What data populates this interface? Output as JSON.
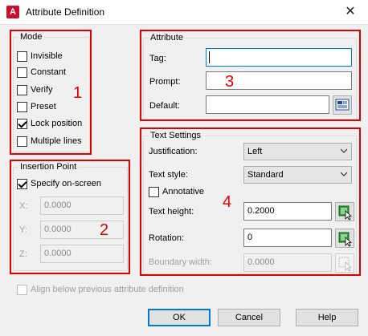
{
  "window": {
    "title": "Attribute Definition",
    "app_icon_letter": "A"
  },
  "mode": {
    "title": "Mode",
    "items": [
      {
        "label": "Invisible",
        "checked": false
      },
      {
        "label": "Constant",
        "checked": false
      },
      {
        "label": "Verify",
        "checked": false
      },
      {
        "label": "Preset",
        "checked": false
      },
      {
        "label": "Lock position",
        "checked": true
      },
      {
        "label": "Multiple lines",
        "checked": false
      }
    ]
  },
  "insertion": {
    "title": "Insertion Point",
    "specify_label": "Specify on-screen",
    "specify_checked": true,
    "x_label": "X:",
    "x_value": "0.0000",
    "y_label": "Y:",
    "y_value": "0.0000",
    "z_label": "Z:",
    "z_value": "0.0000"
  },
  "attribute": {
    "title": "Attribute",
    "tag_label": "Tag:",
    "tag_value": "",
    "prompt_label": "Prompt:",
    "prompt_value": "",
    "default_label": "Default:",
    "default_value": ""
  },
  "text_settings": {
    "title": "Text Settings",
    "justification_label": "Justification:",
    "justification_value": "Left",
    "style_label": "Text style:",
    "style_value": "Standard",
    "annotative_label": "Annotative",
    "annotative_checked": false,
    "height_label": "Text height:",
    "height_value": "0.2000",
    "rotation_label": "Rotation:",
    "rotation_value": "0",
    "boundary_label": "Boundary width:",
    "boundary_value": "0.0000"
  },
  "align_label": "Align below previous attribute definition",
  "buttons": {
    "ok": "OK",
    "cancel": "Cancel",
    "help": "Help"
  },
  "annotations": {
    "n1": "1",
    "n2": "2",
    "n3": "3",
    "n4": "4",
    "color": "#e00000"
  }
}
